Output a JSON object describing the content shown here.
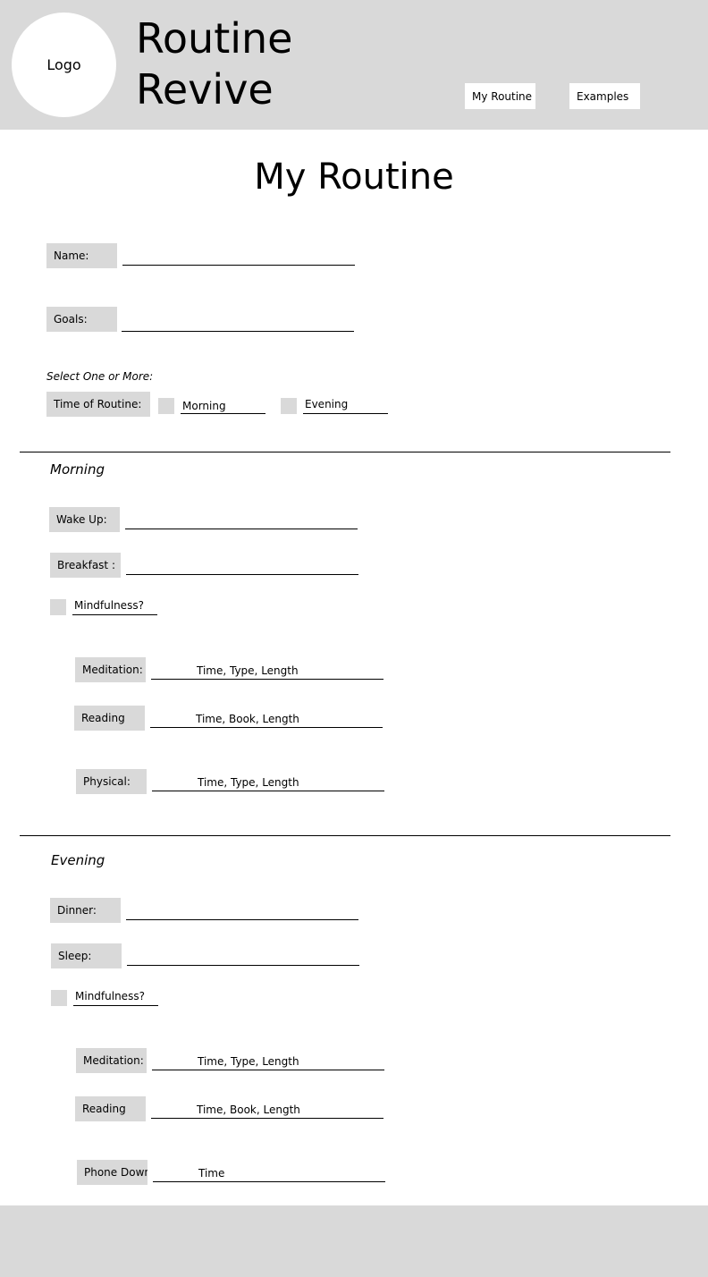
{
  "header": {
    "logo": "Logo",
    "brand_line1": "Routine",
    "brand_line2": "Revive",
    "nav": [
      "My Routine",
      "Examples"
    ]
  },
  "page_title": "My Routine",
  "form": {
    "name_label": "Name:",
    "goals_label": "Goals:",
    "select_hint": "Select One or More:",
    "time_label": "Time of Routine:",
    "time_options": [
      "Morning",
      "Evening"
    ]
  },
  "morning": {
    "heading": "Morning",
    "wake_label": "Wake Up:",
    "breakfast_label": "Breakfast :",
    "mindfulness": "Mindfulness?",
    "meditation_label": "Meditation:",
    "meditation_hint": "Time, Type, Length",
    "reading_label": "Reading",
    "reading_hint": "Time, Book, Length",
    "physical_label": "Physical:",
    "physical_hint": "Time, Type, Length"
  },
  "evening": {
    "heading": "Evening",
    "dinner_label": "Dinner:",
    "sleep_label": "Sleep:",
    "mindfulness": "Mindfulness?",
    "meditation_label": "Meditation:",
    "meditation_hint": "Time, Type, Length",
    "reading_label": "Reading",
    "reading_hint": "Time, Book, Length",
    "phone_label": "Phone Down",
    "phone_hint": "Time"
  }
}
